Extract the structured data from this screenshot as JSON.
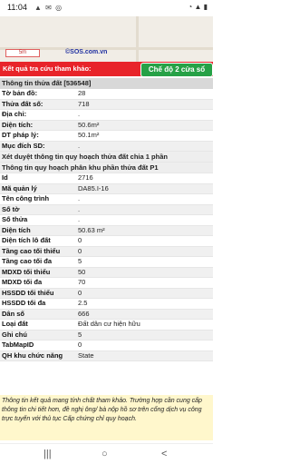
{
  "status": {
    "time": "11:04",
    "left_icons": "▲ ✉ ◎",
    "right_icons": "◔ ▲ ▮"
  },
  "map": {
    "scale_label": "5m",
    "copyright": "©SOS.com.vn"
  },
  "result": {
    "title": "Kết quả tra cứu tham khảo:",
    "mode_button": "Chế độ 2 cửa sổ"
  },
  "section1": {
    "title": "Thông tin thửa đất [536548]"
  },
  "rows1": [
    {
      "label": "Tờ bản đồ:",
      "value": "28"
    },
    {
      "label": "Thửa đất số:",
      "value": "718"
    },
    {
      "label": "Địa chỉ:",
      "value": "."
    },
    {
      "label": "Diện tích:",
      "value": "50.6m²"
    },
    {
      "label": "DT pháp lý:",
      "value": "50.1m²"
    },
    {
      "label": "Mục đích SD:",
      "value": "."
    }
  ],
  "section2": {
    "title": "Xét duyệt thông tin quy hoạch thửa đất chia 1 phần"
  },
  "section3": {
    "title": "Thông tin quy hoạch phân khu phần thửa đất P1"
  },
  "rows2": [
    {
      "label": "Id",
      "value": "2716"
    },
    {
      "label": "Mã quản lý",
      "value": "DA85.I-16"
    },
    {
      "label": "Tên công trình",
      "value": "."
    },
    {
      "label": "Số tờ",
      "value": "."
    },
    {
      "label": "Số thửa",
      "value": "."
    },
    {
      "label": "Diện tích",
      "value": "50.63 m²"
    },
    {
      "label": "Diện tích lô đất",
      "value": "0"
    },
    {
      "label": "Tầng cao tối thiểu",
      "value": "0"
    },
    {
      "label": "Tầng cao tối đa",
      "value": "5"
    },
    {
      "label": "MDXD tối thiểu",
      "value": "50"
    },
    {
      "label": "MDXD tối đa",
      "value": "70"
    },
    {
      "label": "HSSDD tối thiểu",
      "value": "0"
    },
    {
      "label": "HSSDD tối đa",
      "value": "2.5"
    },
    {
      "label": "Dân số",
      "value": "666"
    },
    {
      "label": "Loại đất",
      "value": "Đất dân cư hiện hữu"
    },
    {
      "label": "Ghi chú",
      "value": "5"
    },
    {
      "label": "TabMapID",
      "value": "0"
    },
    {
      "label": "QH khu chức năng",
      "value": "State"
    }
  ],
  "footer": {
    "text": "Thông tin kết quả mang tính chất tham khảo. Trường hợp cần cung cấp thông tin chi tiết hơn, đề nghị ông/ bà nộp hồ sơ trên cổng dịch vụ công trực tuyến với thủ tục Cấp chứng chỉ quy hoạch."
  },
  "nav": {
    "recents": "|||",
    "home": "○",
    "back": "<"
  }
}
